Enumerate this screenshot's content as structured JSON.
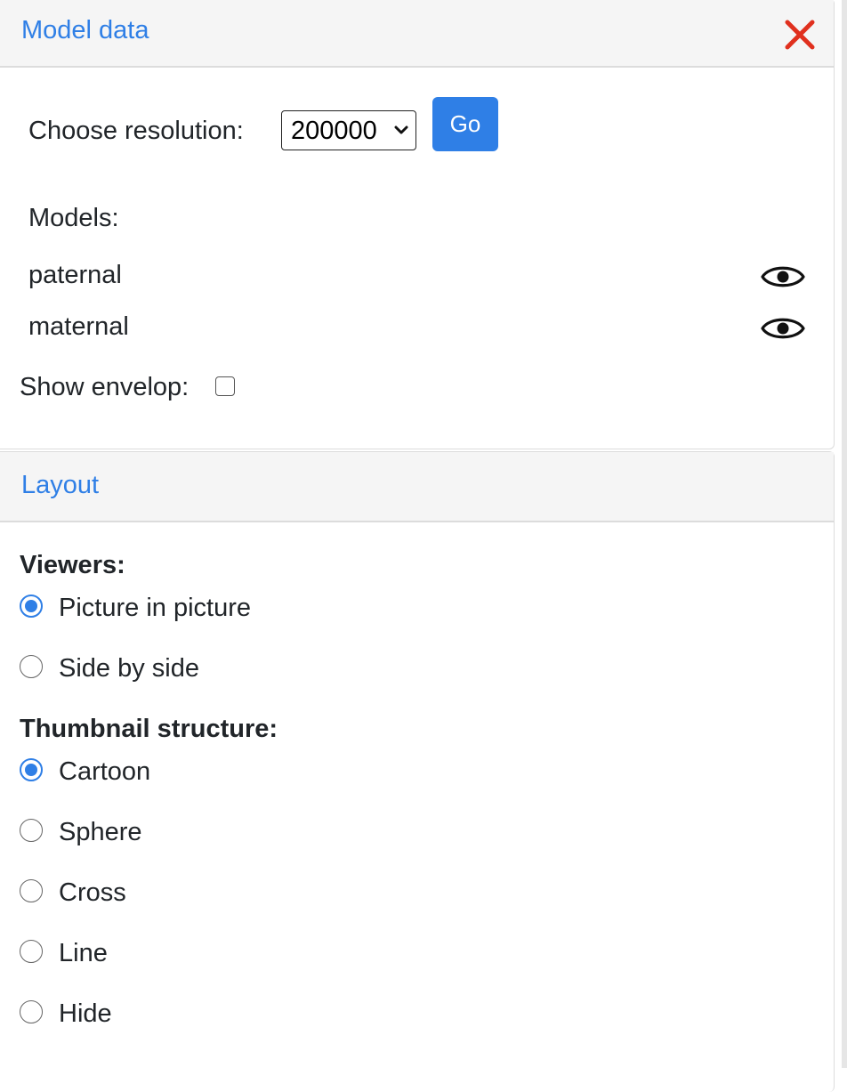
{
  "model_panel": {
    "title": "Model data",
    "close_icon": "close-icon",
    "resolution_label": "Choose resolution:",
    "resolution_value": "200000",
    "go_label": "Go",
    "models_label": "Models:",
    "models": [
      {
        "name": "paternal",
        "icon": "eye-icon"
      },
      {
        "name": "maternal",
        "icon": "eye-icon"
      }
    ],
    "envelop_label": "Show envelop:",
    "envelop_checked": false
  },
  "layout_panel": {
    "title": "Layout",
    "viewers_label": "Viewers:",
    "viewers": [
      {
        "label": "Picture in picture",
        "checked": true
      },
      {
        "label": "Side by side",
        "checked": false
      }
    ],
    "thumbnail_label": "Thumbnail structure:",
    "thumbnails": [
      {
        "label": "Cartoon",
        "checked": true
      },
      {
        "label": "Sphere",
        "checked": false
      },
      {
        "label": "Cross",
        "checked": false
      },
      {
        "label": "Line",
        "checked": false
      },
      {
        "label": "Hide",
        "checked": false
      }
    ]
  },
  "colors": {
    "accent": "#2f7fe6",
    "close": "#e0301e",
    "header_bg": "#f5f5f5"
  }
}
